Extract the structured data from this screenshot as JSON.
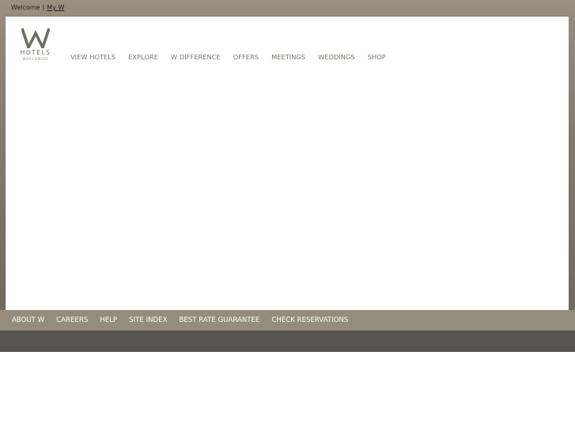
{
  "colors": {
    "top_band": "#8f877a",
    "panel": "#ffffff",
    "footer_nav": "#958c7d",
    "dark_strip": "#575350",
    "nav_text": "#7a756c"
  },
  "header": {
    "welcome_text": "Welcome",
    "separator": "|",
    "my_w_link": "My W"
  },
  "logo": {
    "mark": "W",
    "text": "HOTELS",
    "subtext": "WORLDWIDE",
    "icon": "w-hotels-logo"
  },
  "main_nav": {
    "items": [
      {
        "label": "VIEW HOTELS"
      },
      {
        "label": "EXPLORE"
      },
      {
        "label": "W DIFFERENCE"
      },
      {
        "label": "OFFERS"
      },
      {
        "label": "MEETINGS"
      },
      {
        "label": "WEDDINGS"
      },
      {
        "label": "SHOP"
      }
    ]
  },
  "footer_nav": {
    "items": [
      {
        "label": "ABOUT W"
      },
      {
        "label": "CAREERS"
      },
      {
        "label": "HELP"
      },
      {
        "label": "SITE INDEX"
      },
      {
        "label": "BEST RATE GUARANTEE"
      },
      {
        "label": "CHECK RESERVATIONS"
      }
    ]
  }
}
